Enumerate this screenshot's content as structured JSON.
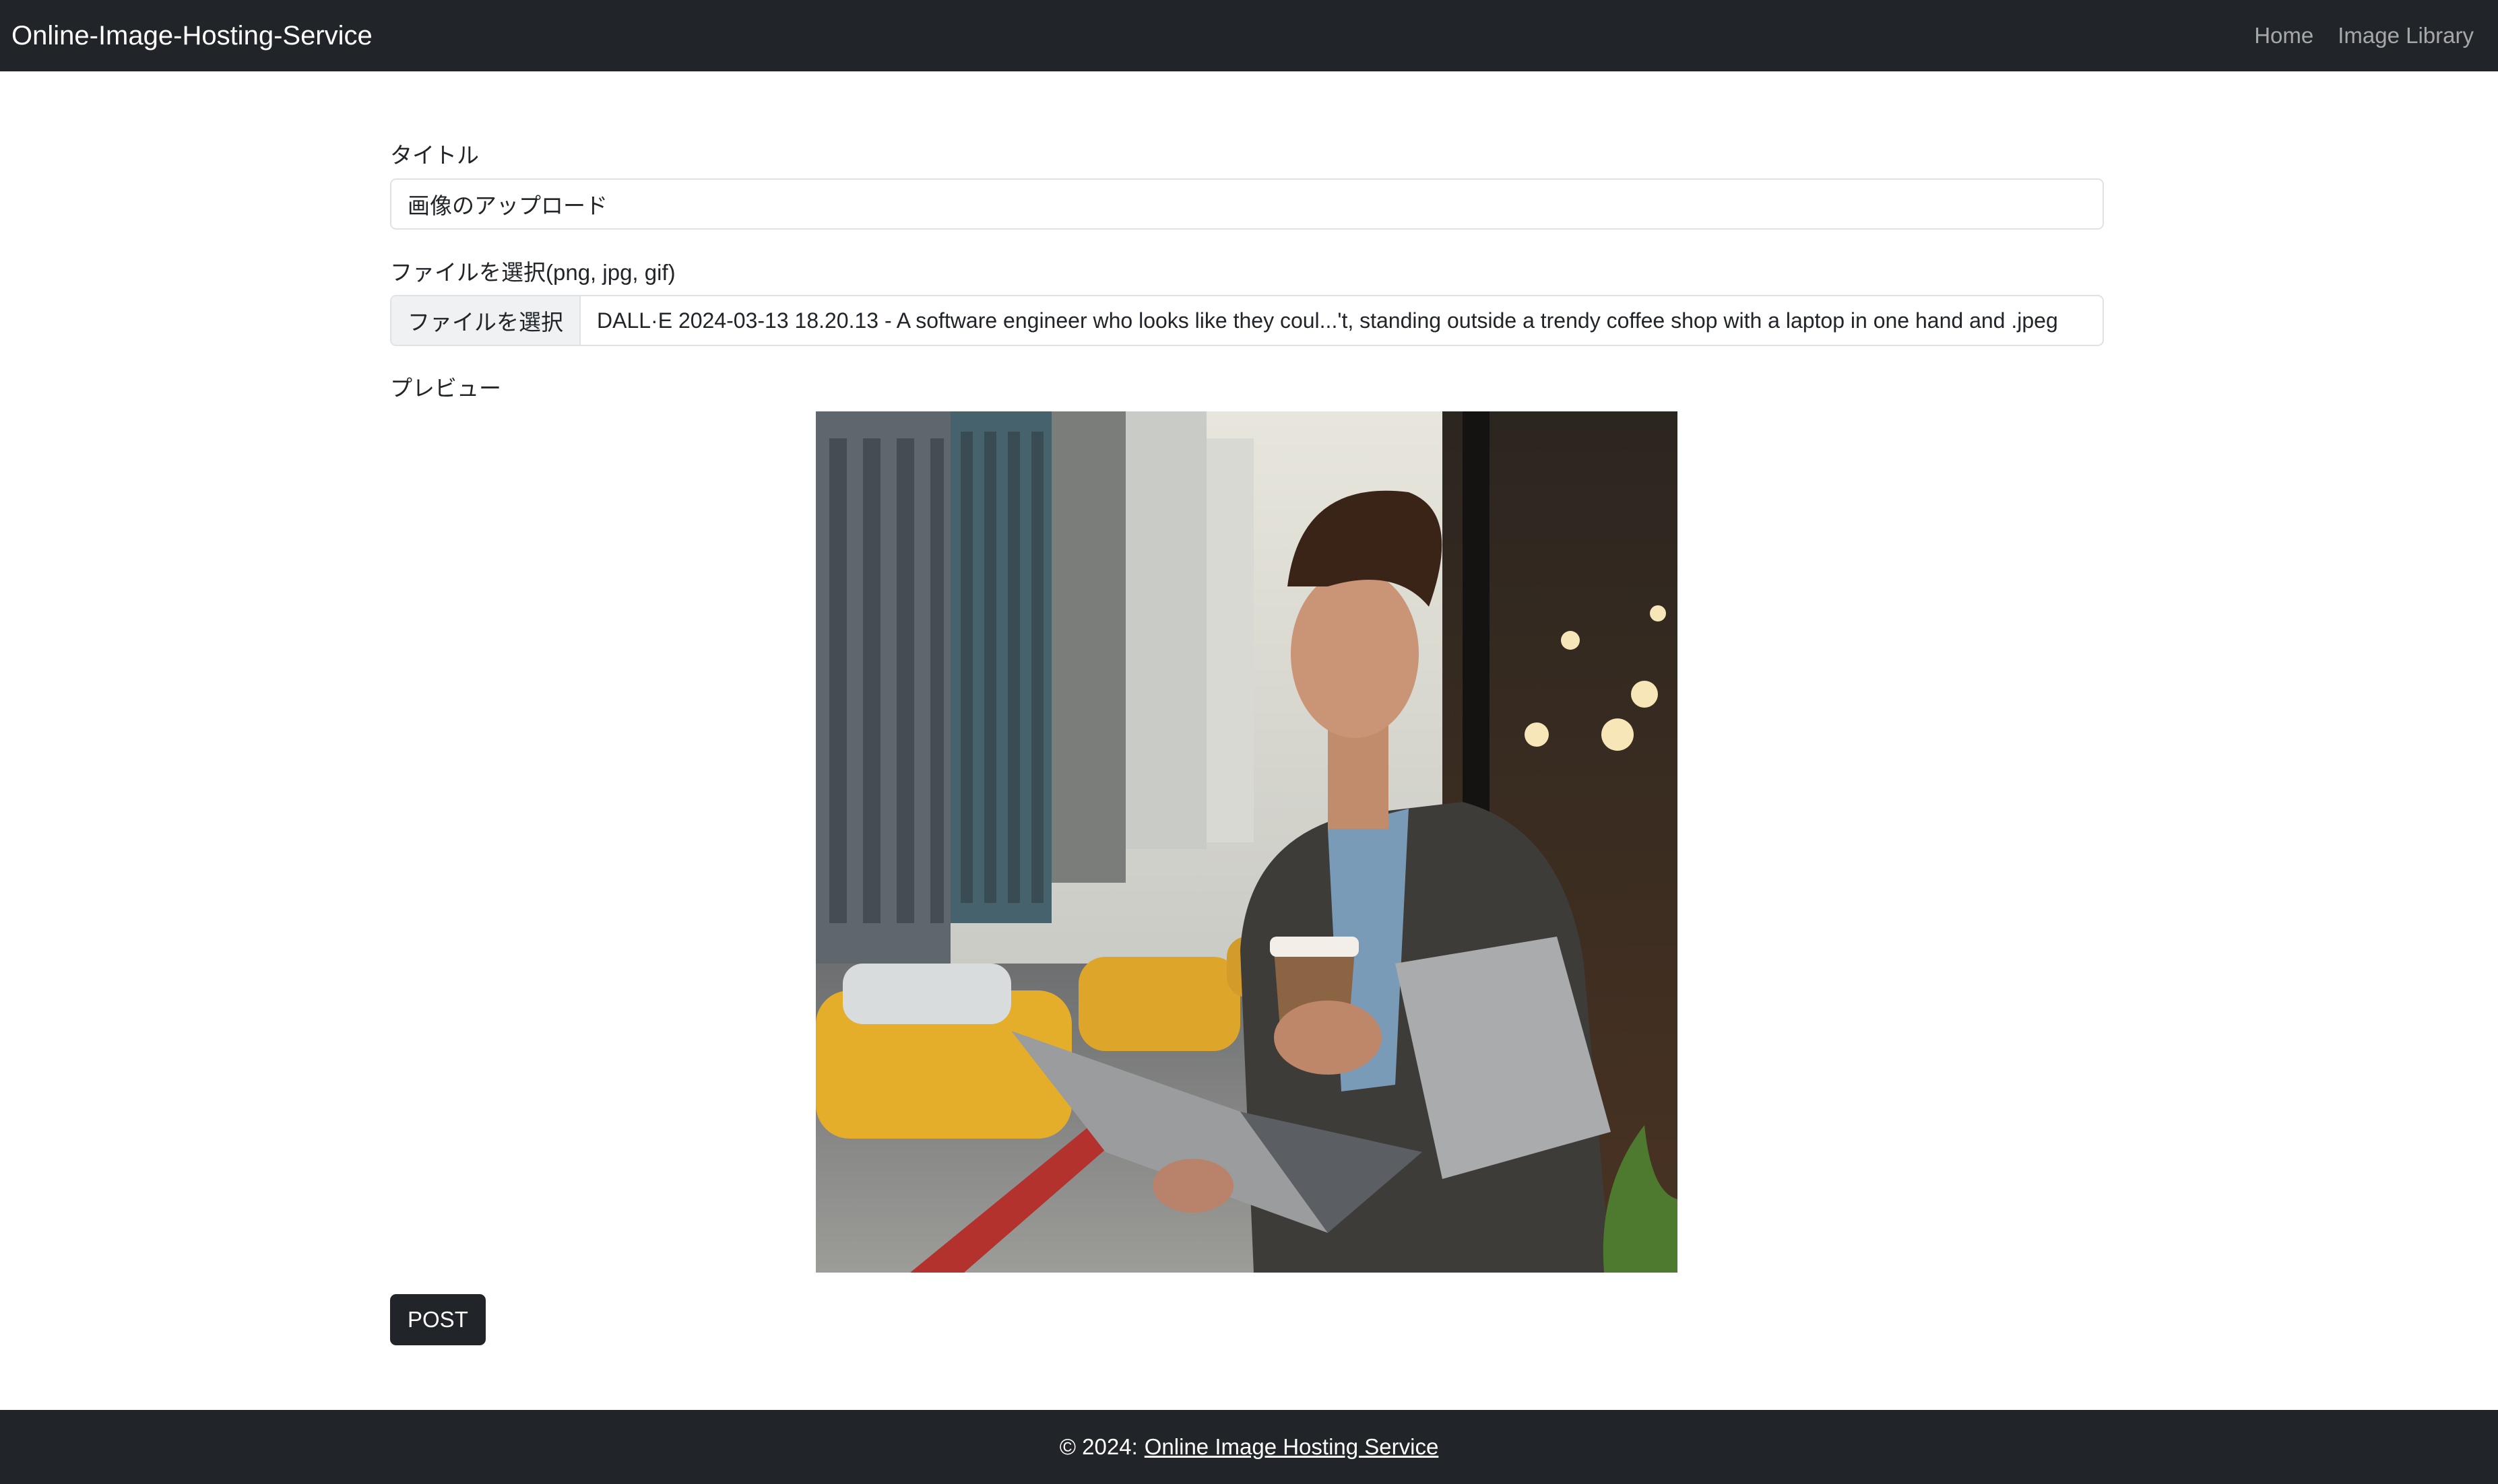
{
  "navbar": {
    "brand": "Online-Image-Hosting-Service",
    "links": [
      {
        "label": "Home"
      },
      {
        "label": "Image Library"
      }
    ]
  },
  "form": {
    "title_label": "タイトル",
    "title_value": "画像のアップロード",
    "file_label": "ファイルを選択(png, jpg, gif)",
    "file_button": "ファイルを選択",
    "file_name": "DALL·E 2024-03-13 18.20.13 - A software engineer who looks like they coul...'t, standing outside a trendy coffee shop with a laptop in one hand and .jpeg",
    "preview_label": "プレビュー",
    "submit_label": "POST"
  },
  "footer": {
    "prefix": "© 2024:",
    "link_text": "Online Image Hosting Service"
  },
  "colors": {
    "navbar_bg": "#212529",
    "button_bg": "#212529",
    "text": "#212529",
    "border": "#dee2e6"
  },
  "preview_image": {
    "icon": "photo-preview-image"
  }
}
